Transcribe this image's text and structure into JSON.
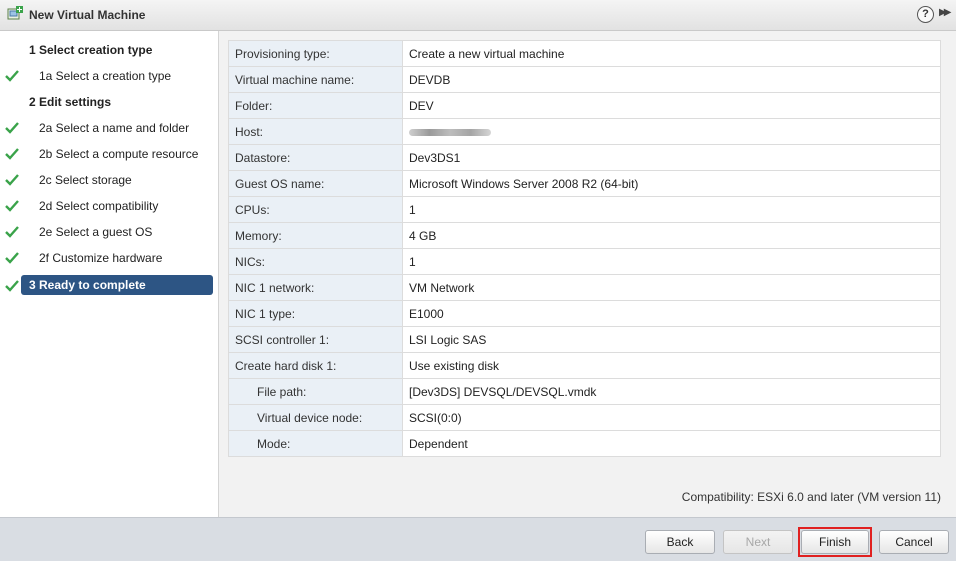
{
  "window": {
    "title": "New Virtual Machine",
    "help_label": "?",
    "expand_label": "▶▶"
  },
  "colors": {
    "active_step": "#2d5584",
    "check": "#3aa34a",
    "highlight_border": "#e02020"
  },
  "sidebar": {
    "steps": [
      {
        "label": "1  Select creation type",
        "kind": "heading",
        "done": false
      },
      {
        "label": "1a  Select a creation type",
        "kind": "sub",
        "done": true
      },
      {
        "label": "2  Edit settings",
        "kind": "heading",
        "done": false
      },
      {
        "label": "2a  Select a name and folder",
        "kind": "sub",
        "done": true
      },
      {
        "label": "2b  Select a compute resource",
        "kind": "sub",
        "done": true
      },
      {
        "label": "2c  Select storage",
        "kind": "sub",
        "done": true
      },
      {
        "label": "2d  Select compatibility",
        "kind": "sub",
        "done": true
      },
      {
        "label": "2e  Select a guest OS",
        "kind": "sub",
        "done": true
      },
      {
        "label": "2f  Customize hardware",
        "kind": "sub",
        "done": true
      },
      {
        "label": "3  Ready to complete",
        "kind": "active",
        "done": true
      }
    ]
  },
  "summary": {
    "rows": [
      {
        "key": "Provisioning type:",
        "value": "Create a new virtual machine"
      },
      {
        "key": "Virtual machine name:",
        "value": "DEVDB"
      },
      {
        "key": "Folder:",
        "value": "DEV"
      },
      {
        "key": "Host:",
        "value": ""
      },
      {
        "key": "Datastore:",
        "value": "Dev3DS1"
      },
      {
        "key": "Guest OS name:",
        "value": "Microsoft Windows Server 2008 R2 (64-bit)"
      },
      {
        "key": "CPUs:",
        "value": "1"
      },
      {
        "key": "Memory:",
        "value": "4 GB"
      },
      {
        "key": "NICs:",
        "value": "1"
      },
      {
        "key": "NIC 1 network:",
        "value": "VM Network"
      },
      {
        "key": "NIC 1 type:",
        "value": "E1000"
      },
      {
        "key": "SCSI controller 1:",
        "value": "LSI Logic SAS"
      },
      {
        "key": "Create hard disk 1:",
        "value": "Use existing disk"
      },
      {
        "key": "File path:",
        "value": "[Dev3DS] DEVSQL/DEVSQL.vmdk"
      },
      {
        "key": "Virtual device node:",
        "value": "SCSI(0:0)"
      },
      {
        "key": "Mode:",
        "value": "Dependent"
      }
    ],
    "compatibility": "Compatibility: ESXi 6.0 and later (VM version 11)"
  },
  "footer": {
    "back_label": "Back",
    "next_label": "Next",
    "finish_label": "Finish",
    "cancel_label": "Cancel"
  }
}
